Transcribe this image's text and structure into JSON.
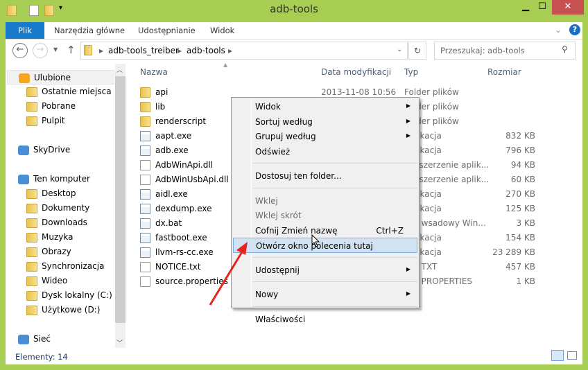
{
  "window": {
    "title": "adb-tools",
    "minimize_icon": "minimize-icon",
    "maximize_icon": "maximize-icon",
    "close_icon": "close-icon"
  },
  "ribbon": {
    "tabs": [
      "Plik",
      "Narzędzia główne",
      "Udostępnianie",
      "Widok"
    ],
    "accent": "#1979ca"
  },
  "address": {
    "crumbs": [
      "adb-tools_treiber",
      "adb-tools"
    ],
    "search_placeholder": "Przeszukaj: adb-tools"
  },
  "sidebar": {
    "groups": [
      {
        "label": "Ulubione",
        "icon": "star-icon",
        "items": [
          {
            "label": "Ostatnie miejsca",
            "icon": "recent-places-icon"
          },
          {
            "label": "Pobrane",
            "icon": "downloads-folder-icon"
          },
          {
            "label": "Pulpit",
            "icon": "desktop-icon"
          }
        ]
      },
      {
        "label": "SkyDrive",
        "icon": "skydrive-icon",
        "items": []
      },
      {
        "label": "Ten komputer",
        "icon": "computer-icon",
        "items": [
          {
            "label": "Desktop",
            "icon": "folder-icon"
          },
          {
            "label": "Dokumenty",
            "icon": "documents-folder-icon"
          },
          {
            "label": "Downloads",
            "icon": "downloads-folder-icon"
          },
          {
            "label": "Muzyka",
            "icon": "music-folder-icon"
          },
          {
            "label": "Obrazy",
            "icon": "pictures-folder-icon"
          },
          {
            "label": "Synchronizacja",
            "icon": "folder-icon"
          },
          {
            "label": "Wideo",
            "icon": "video-folder-icon"
          },
          {
            "label": "Dysk lokalny (C:)",
            "icon": "windows-drive-icon"
          },
          {
            "label": "Użytkowe (D:)",
            "icon": "drive-icon"
          }
        ]
      },
      {
        "label": "Sieć",
        "icon": "network-icon",
        "items": []
      }
    ]
  },
  "columns": {
    "name": "Nazwa",
    "date": "Data modyfikacji",
    "type": "Typ",
    "size": "Rozmiar"
  },
  "files": [
    {
      "name": "api",
      "date": "2013-11-08 10:56",
      "type": "Folder plików",
      "size": "",
      "icon": "folder"
    },
    {
      "name": "lib",
      "date": "",
      "type": "Folder plików",
      "size": "",
      "icon": "folder"
    },
    {
      "name": "renderscript",
      "date": "",
      "type": "Folder plików",
      "size": "",
      "icon": "folder"
    },
    {
      "name": "aapt.exe",
      "date": "",
      "type": "Aplikacja",
      "size": "832 KB",
      "icon": "exe"
    },
    {
      "name": "adb.exe",
      "date": "",
      "type": "Aplikacja",
      "size": "796 KB",
      "icon": "exe"
    },
    {
      "name": "AdbWinApi.dll",
      "date": "",
      "type": "Rozszerzenie aplik...",
      "size": "94 KB",
      "icon": "dll"
    },
    {
      "name": "AdbWinUsbApi.dll",
      "date": "",
      "type": "Rozszerzenie aplik...",
      "size": "60 KB",
      "icon": "dll"
    },
    {
      "name": "aidl.exe",
      "date": "",
      "type": "Aplikacja",
      "size": "270 KB",
      "icon": "exe"
    },
    {
      "name": "dexdump.exe",
      "date": "",
      "type": "Aplikacja",
      "size": "125 KB",
      "icon": "exe"
    },
    {
      "name": "dx.bat",
      "date": "",
      "type": "Plik wsadowy Win...",
      "size": "3 KB",
      "icon": "bat"
    },
    {
      "name": "fastboot.exe",
      "date": "",
      "type": "Aplikacja",
      "size": "154 KB",
      "icon": "exe"
    },
    {
      "name": "llvm-rs-cc.exe",
      "date": "",
      "type": "Aplikacja",
      "size": "23 289 KB",
      "icon": "exe"
    },
    {
      "name": "NOTICE.txt",
      "date": "",
      "type": "Plik TXT",
      "size": "457 KB",
      "icon": "txt"
    },
    {
      "name": "source.properties",
      "date": "",
      "type": "Plik PROPERTIES",
      "size": "1 KB",
      "icon": "file"
    }
  ],
  "context_menu": {
    "items": [
      {
        "label": "Widok",
        "submenu": true
      },
      {
        "label": "Sortuj według",
        "submenu": true
      },
      {
        "label": "Grupuj według",
        "submenu": true
      },
      {
        "label": "Odśwież"
      },
      {
        "separator": true
      },
      {
        "label": "Dostosuj ten folder..."
      },
      {
        "separator": true
      },
      {
        "label": "Wklej",
        "disabled": true
      },
      {
        "label": "Wklej skrót",
        "disabled": true
      },
      {
        "label": "Cofnij Zmień nazwę",
        "shortcut": "Ctrl+Z"
      },
      {
        "label": "Otwórz okno polecenia tutaj",
        "highlighted": true
      },
      {
        "separator": true
      },
      {
        "label": "Udostępnij",
        "submenu": true
      },
      {
        "separator": true
      },
      {
        "label": "Nowy",
        "submenu": true
      },
      {
        "separator": true
      },
      {
        "label": "Właściwości"
      }
    ]
  },
  "status": {
    "items_count": "Elementy: 14"
  },
  "annotation": {
    "arrow_color": "#e8221c"
  }
}
